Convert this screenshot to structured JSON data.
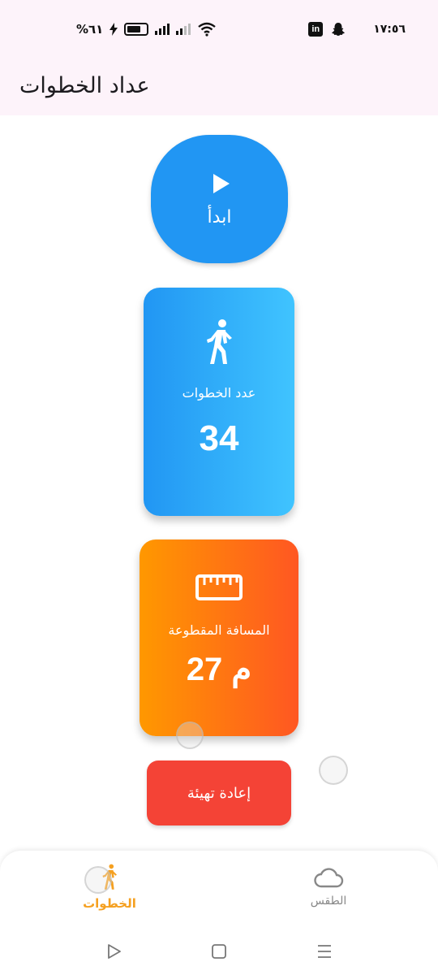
{
  "status_bar": {
    "battery_text": "%٦١",
    "time": "١٧:٥٦",
    "linkedin_icon_text": "in"
  },
  "app_bar": {
    "title": "عداد الخطوات"
  },
  "start_button": {
    "label": "ابدأ",
    "icon": "play-icon"
  },
  "steps_card": {
    "label": "عدد الخطوات",
    "value": "34",
    "icon": "walking-person-icon"
  },
  "distance_card": {
    "label": "المسافة المقطوعة",
    "value": "27 م",
    "icon": "ruler-icon"
  },
  "reset_button": {
    "label": "إعادة تهيئة"
  },
  "bottom_nav": {
    "items": [
      {
        "label": "الخطوات",
        "icon": "walking-person-icon",
        "active": true
      },
      {
        "label": "الطقس",
        "icon": "cloud-icon",
        "active": false
      }
    ]
  },
  "colors": {
    "primary_blue": "#2196f3",
    "light_blue": "#40c4ff",
    "orange": "#ff9800",
    "deep_orange": "#ff5722",
    "red": "#f44336",
    "active_nav": "#f5a020",
    "app_bar_bg": "#fdf3fa"
  }
}
